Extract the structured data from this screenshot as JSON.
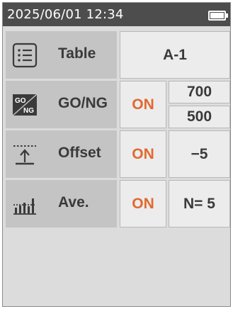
{
  "status_bar": {
    "datetime": "2025/06/01  12:34",
    "battery_icon": "battery-full-icon"
  },
  "rows": {
    "table": {
      "icon": "list-icon",
      "label": "Table",
      "value": "A-1"
    },
    "gong": {
      "icon": "go-ng-icon",
      "icon_top_text": "GO",
      "icon_bottom_text": "NG",
      "label": "GO/NG",
      "state": "ON",
      "upper_limit": "700",
      "lower_limit": "500"
    },
    "offset": {
      "icon": "offset-arrow-icon",
      "label": "Offset",
      "state": "ON",
      "value": "−5"
    },
    "average": {
      "icon": "bar-average-icon",
      "label": "Ave.",
      "state": "ON",
      "value": "N= 5"
    }
  },
  "colors": {
    "status_bar": "#4d4d4d",
    "label_bg": "#c4c4c4",
    "cell_bg": "#ececec",
    "on_text": "#e06a30",
    "screen_bg": "#dcdcdc"
  }
}
